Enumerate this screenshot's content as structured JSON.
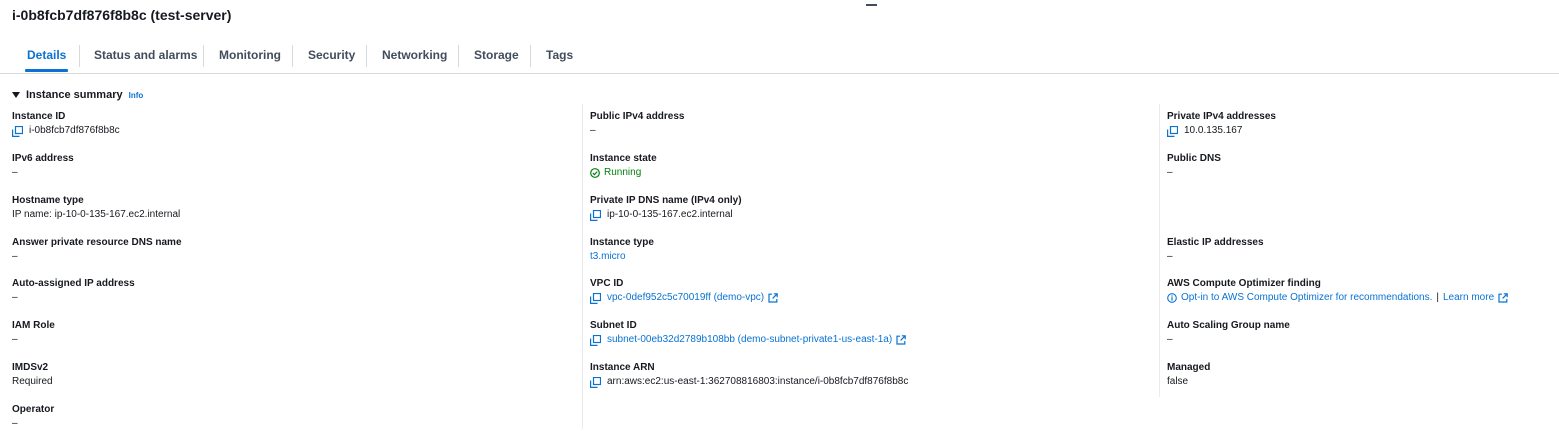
{
  "header": {
    "title": "i-0b8fcb7df876f8b8c (test-server)"
  },
  "tabs": [
    "Details",
    "Status and alarms",
    "Monitoring",
    "Security",
    "Networking",
    "Storage",
    "Tags"
  ],
  "section": {
    "title": "Instance summary",
    "info": "Info"
  },
  "col1": [
    {
      "label": "Instance ID",
      "value": "i-0b8fcb7df876f8b8c"
    },
    {
      "label": "IPv6 address",
      "value": "–"
    },
    {
      "label": "Hostname type",
      "value": "IP name: ip-10-0-135-167.ec2.internal"
    },
    {
      "label": "Answer private resource DNS name",
      "value": "–"
    },
    {
      "label": "Auto-assigned IP address",
      "value": "–"
    },
    {
      "label": "IAM Role",
      "value": "–"
    },
    {
      "label": "IMDSv2",
      "value": "Required"
    },
    {
      "label": "Operator",
      "value": "–"
    }
  ],
  "col2": [
    {
      "label": "Public IPv4 address",
      "value": "–"
    },
    {
      "label": "Instance state",
      "value": "Running"
    },
    {
      "label": "Private IP DNS name (IPv4 only)",
      "value": "ip-10-0-135-167.ec2.internal"
    },
    {
      "label": "Instance type",
      "value": "t3.micro"
    },
    {
      "label": "VPC ID",
      "value": "vpc-0def952c5c70019ff (demo-vpc)"
    },
    {
      "label": "Subnet ID",
      "value": "subnet-00eb32d2789b108bb (demo-subnet-private1-us-east-1a)"
    },
    {
      "label": "Instance ARN",
      "value": "arn:aws:ec2:us-east-1:362708816803:instance/i-0b8fcb7df876f8b8c"
    }
  ],
  "col3": [
    {
      "label": "Private IPv4 addresses",
      "value": "10.0.135.167"
    },
    {
      "label": "Public DNS",
      "value": "–"
    },
    {
      "label": "Elastic IP addresses",
      "value": "–"
    },
    {
      "label": "AWS Compute Optimizer finding",
      "value": "Opt-in to AWS Compute Optimizer for recommendations.",
      "pipe": "|",
      "link": "Learn more"
    },
    {
      "label": "Auto Scaling Group name",
      "value": "–"
    },
    {
      "label": "Managed",
      "value": "false"
    }
  ],
  "colors": {
    "accent": "#0972d3",
    "success": "#037f0c",
    "text": "#16191f",
    "divider": "#d5dbdb"
  },
  "icons": [
    "copy-icon",
    "external-link-icon",
    "status-ok-icon",
    "info-icon",
    "caret-down-icon"
  ]
}
